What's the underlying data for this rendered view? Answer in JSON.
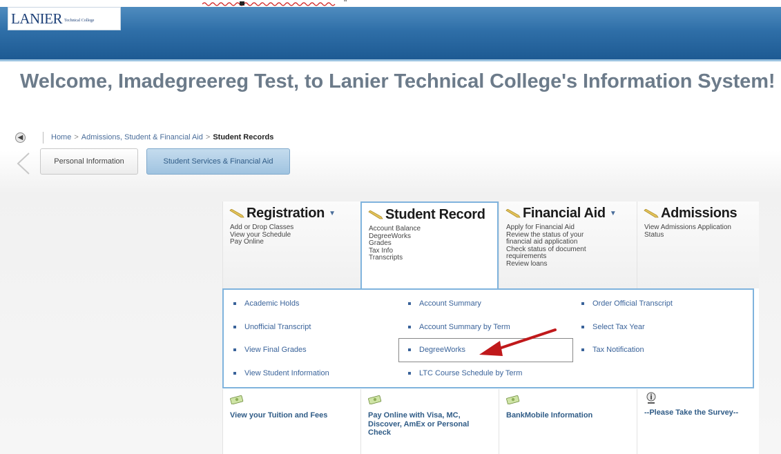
{
  "header": {
    "logo_main": "LANIER",
    "logo_sub": "Technical College",
    "bg_color": "#2f6fa8"
  },
  "welcome": "Welcome, Imadegreereg Test, to Lanier Technical College's Information System!",
  "breadcrumb": {
    "home": "Home",
    "section": "Admissions, Student & Financial Aid",
    "current": "Student Records",
    "separator": ">"
  },
  "tabs": {
    "personal": "Personal Information",
    "services": "Student Services & Financial Aid"
  },
  "categories": [
    {
      "title": "Registration",
      "lines": [
        "Add or Drop Classes",
        "View your Schedule",
        "Pay Online"
      ]
    },
    {
      "title": "Student Record",
      "lines": [
        "Account Balance",
        "DegreeWorks",
        "Grades",
        "Tax Info",
        "Transcripts"
      ]
    },
    {
      "title": "Financial Aid",
      "lines": [
        "Apply for Financial Aid",
        "Review the status of your",
        "financial aid application",
        "Check status of document",
        "requirements",
        "Review loans"
      ]
    },
    {
      "title": "Admissions",
      "lines": [
        "View Admissions Application",
        "Status"
      ]
    }
  ],
  "items": {
    "academic_holds": "Academic Holds",
    "unofficial_transcript": "Unofficial Transcript",
    "view_final_grades": "View Final Grades",
    "view_student_information": "View Student Information",
    "account_summary": "Account Summary",
    "account_summary_by_term": "Account Summary by Term",
    "degreeworks": "DegreeWorks",
    "ltc_course_schedule": "LTC Course Schedule by Term",
    "order_official_transcript": "Order Official Transcript",
    "select_tax_year": "Select Tax Year",
    "tax_notification": "Tax Notification"
  },
  "bottom": {
    "tuition": [
      "View your Tuition and Fees"
    ],
    "pay_online": [
      "Pay Online with Visa, MC,",
      "Discover, AmEx or Personal",
      "Check"
    ],
    "bankmobile": [
      "BankMobile Information"
    ],
    "survey": [
      "--Please Take the Survey--"
    ]
  },
  "accent_color": "#7fb3dd",
  "link_color": "#3a639a",
  "arrow_color": "#c0191b"
}
